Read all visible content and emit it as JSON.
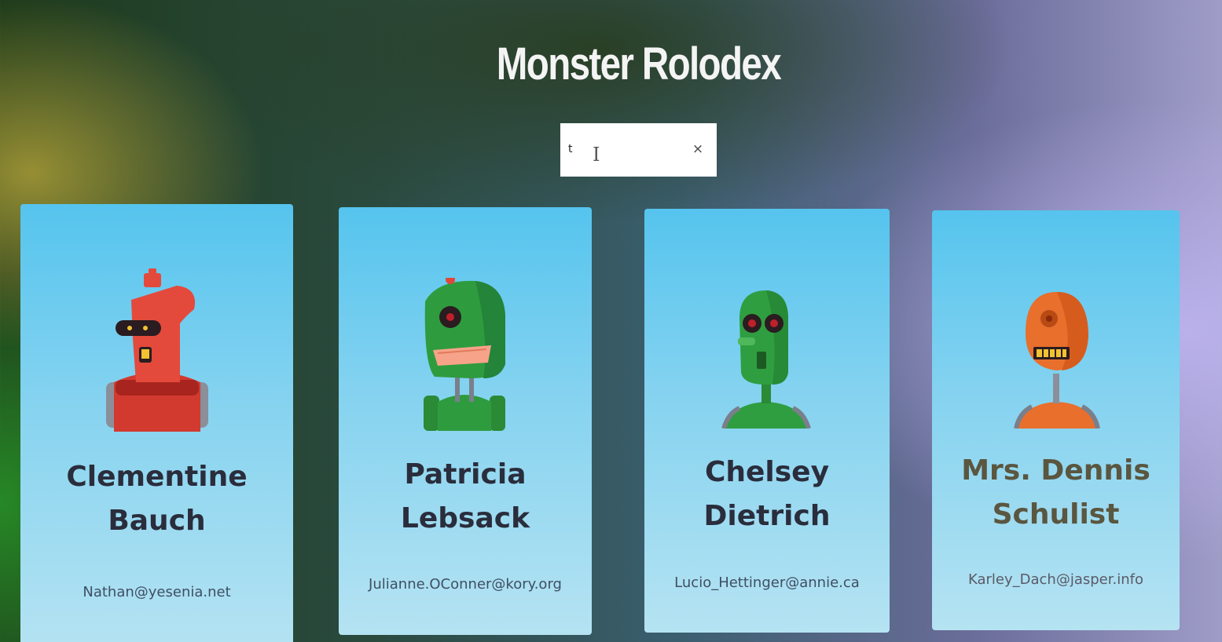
{
  "app": {
    "title": "Monster Rolodex"
  },
  "search": {
    "value": "t",
    "placeholder": "",
    "clear_label": "×"
  },
  "monsters": [
    {
      "first": "Clementine",
      "last": "Bauch",
      "email": "Nathan@yesenia.net",
      "robot_color": "#e0473a",
      "robot_icon": "red-robot-icon"
    },
    {
      "first": "Patricia",
      "last": "Lebsack",
      "email": "Julianne.OConner@kory.org",
      "robot_color": "#2e9c3e",
      "robot_icon": "green-robot-icon"
    },
    {
      "first": "Chelsey",
      "last": "Dietrich",
      "email": "Lucio_Hettinger@annie.ca",
      "robot_color": "#2f9e40",
      "robot_icon": "green-robot-icon"
    },
    {
      "first": "Mrs. Dennis",
      "last": "Schulist",
      "email": "Karley_Dach@jasper.info",
      "robot_color": "#e86f2c",
      "robot_icon": "orange-robot-icon"
    }
  ]
}
